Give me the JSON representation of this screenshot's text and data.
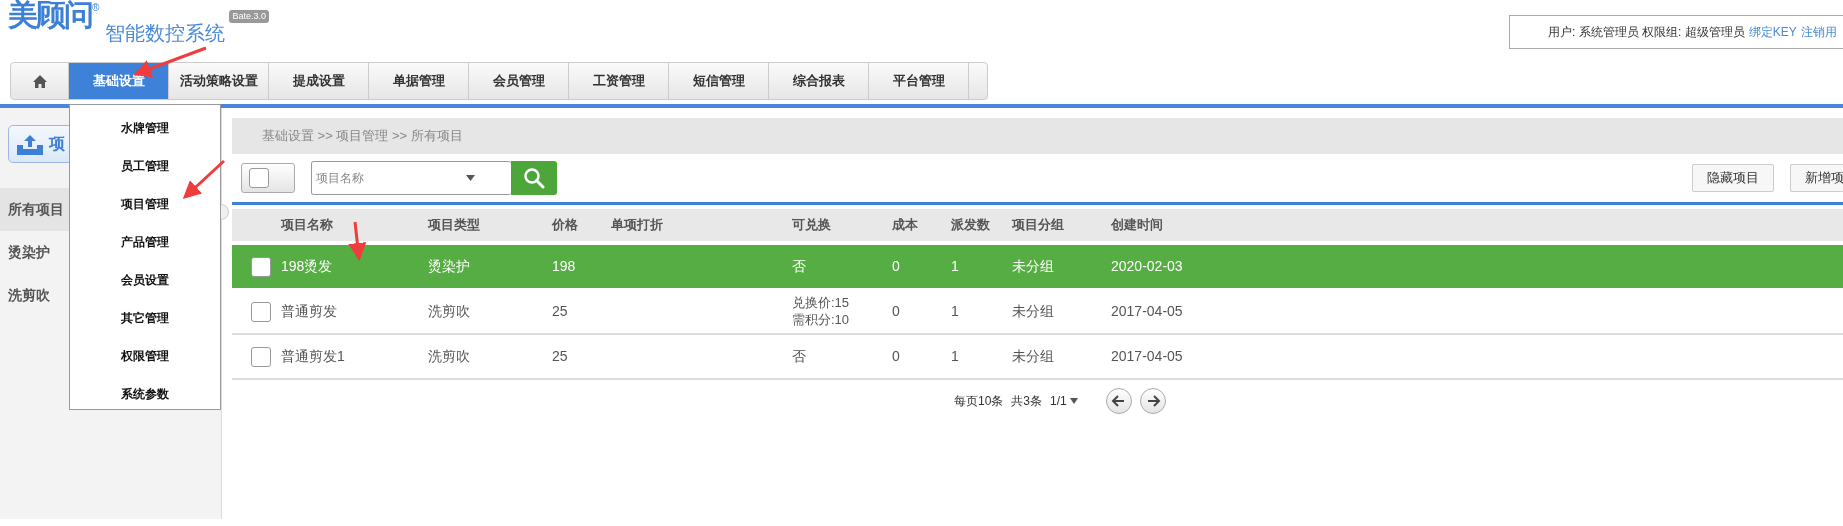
{
  "logo": {
    "brand": "美顾问",
    "registered": "®",
    "product": "智能数控系统",
    "version": "Bate.3.0"
  },
  "user_bar": {
    "text": "用户: 系统管理员 权限组: 超级管理员",
    "links": [
      "绑定KEY",
      "注销用"
    ]
  },
  "nav": [
    {
      "kind": "home",
      "selected": false
    },
    {
      "kind": "tab",
      "label": "基础设置",
      "selected": true
    },
    {
      "kind": "tab",
      "label": "活动策略设置",
      "selected": false
    },
    {
      "kind": "tab",
      "label": "提成设置",
      "selected": false
    },
    {
      "kind": "tab",
      "label": "单据管理",
      "selected": false
    },
    {
      "kind": "tab",
      "label": "会员管理",
      "selected": false
    },
    {
      "kind": "tab",
      "label": "工资管理",
      "selected": false
    },
    {
      "kind": "tab",
      "label": "短信管理",
      "selected": false
    },
    {
      "kind": "tab",
      "label": "综合报表",
      "selected": false
    },
    {
      "kind": "tab",
      "label": "平台管理",
      "selected": false
    }
  ],
  "dropdown": [
    "水牌管理",
    "员工管理",
    "项目管理",
    "产品管理",
    "会员设置",
    "其它管理",
    "权限管理",
    "系统参数"
  ],
  "sidebar": {
    "button": "项",
    "items": [
      {
        "label": "所有项目",
        "selected": true
      },
      {
        "label": "烫染护",
        "selected": false
      },
      {
        "label": "洗剪吹",
        "selected": false
      }
    ]
  },
  "breadcrumb": "基础设置 >> 项目管理 >> 所有项目",
  "toolbar": {
    "search": {
      "placeholder": "项目名称"
    },
    "buttons": [
      "隐藏项目",
      "新增项"
    ]
  },
  "table": {
    "columns": [
      {
        "label": "项目名称",
        "kind": "text"
      },
      {
        "label": "项目类型",
        "kind": "text"
      },
      {
        "label": "价格",
        "kind": "text"
      },
      {
        "label": "单项打折",
        "kind": "text"
      },
      {
        "label": "可兑换",
        "kind": "lines"
      },
      {
        "label": "成本",
        "kind": "text"
      },
      {
        "label": "派发数",
        "kind": "text"
      },
      {
        "label": "项目分组",
        "kind": "text"
      },
      {
        "label": "创建时间",
        "kind": "text"
      }
    ],
    "rows": [
      {
        "selected": true,
        "checked": false,
        "cells": [
          "198烫发",
          "烫染护",
          "198",
          "",
          [
            "否"
          ],
          "0",
          "1",
          "未分组",
          "2020-02-03"
        ]
      },
      {
        "selected": false,
        "checked": false,
        "cells": [
          "普通剪发",
          "洗剪吹",
          "25",
          "",
          [
            "兑换价:15",
            "需积分:10"
          ],
          "0",
          "1",
          "未分组",
          "2017-04-05"
        ]
      },
      {
        "selected": false,
        "checked": false,
        "cells": [
          "普通剪发1",
          "洗剪吹",
          "25",
          "",
          [
            "否"
          ],
          "0",
          "1",
          "未分组",
          "2017-04-05"
        ]
      }
    ]
  },
  "pagination": {
    "per_page": "每页10条",
    "total": "共3条",
    "page": "1/1"
  }
}
